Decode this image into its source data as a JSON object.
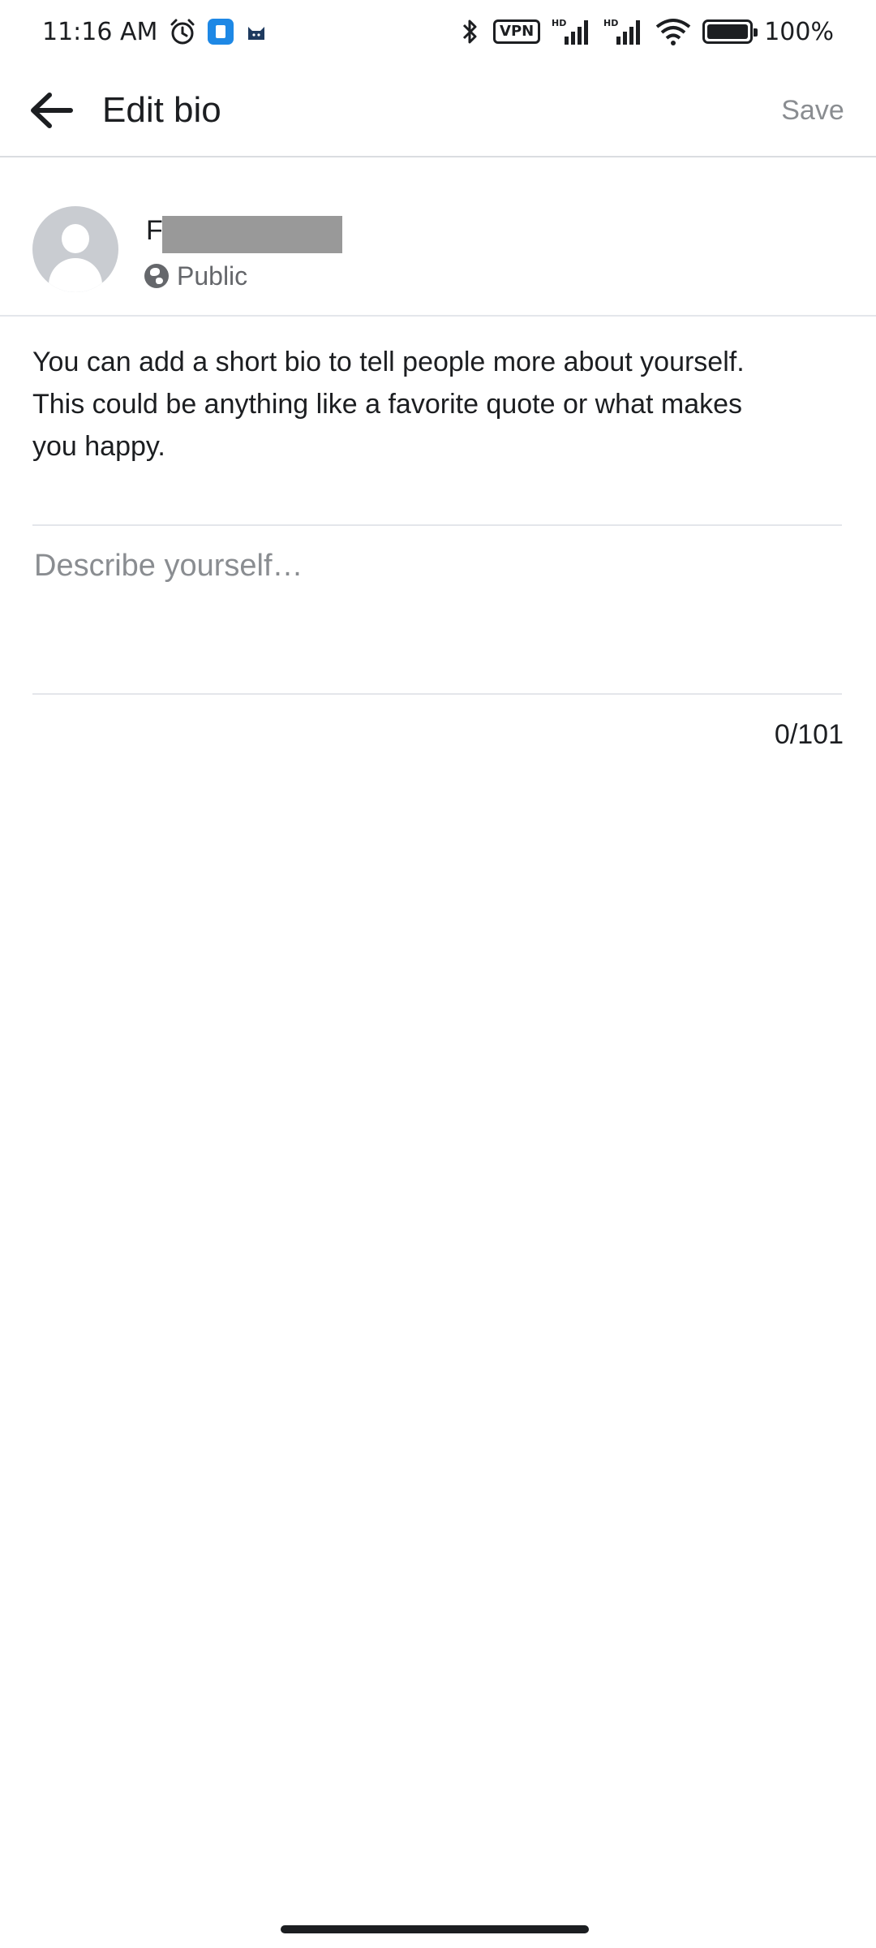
{
  "status_bar": {
    "time": "11:16 AM",
    "vpn": "VPN",
    "network_1": "HD",
    "network_2": "HD",
    "battery_text": "100%",
    "icons": [
      "alarm-icon",
      "app-icon",
      "cat-icon",
      "bluetooth-icon",
      "vpn-icon",
      "signal-icon",
      "wifi-icon",
      "battery-icon"
    ]
  },
  "header": {
    "back_icon": "arrow-left-icon",
    "title": "Edit bio",
    "save_label": "Save"
  },
  "profile": {
    "name_initial": "F",
    "privacy_label": "Public",
    "privacy_icon": "globe-icon"
  },
  "bio": {
    "help_lines": [
      "You can add a short bio to tell people more about yourself.",
      "This could be anything like a favorite quote or what makes",
      "you happy."
    ],
    "placeholder": "Describe yourself…",
    "value": "",
    "counter": "0/101"
  },
  "colors": {
    "text": "#1c1e21",
    "muted": "#8a8d91",
    "divider": "#e4e6eb",
    "avatar": "#c9ccd1"
  }
}
